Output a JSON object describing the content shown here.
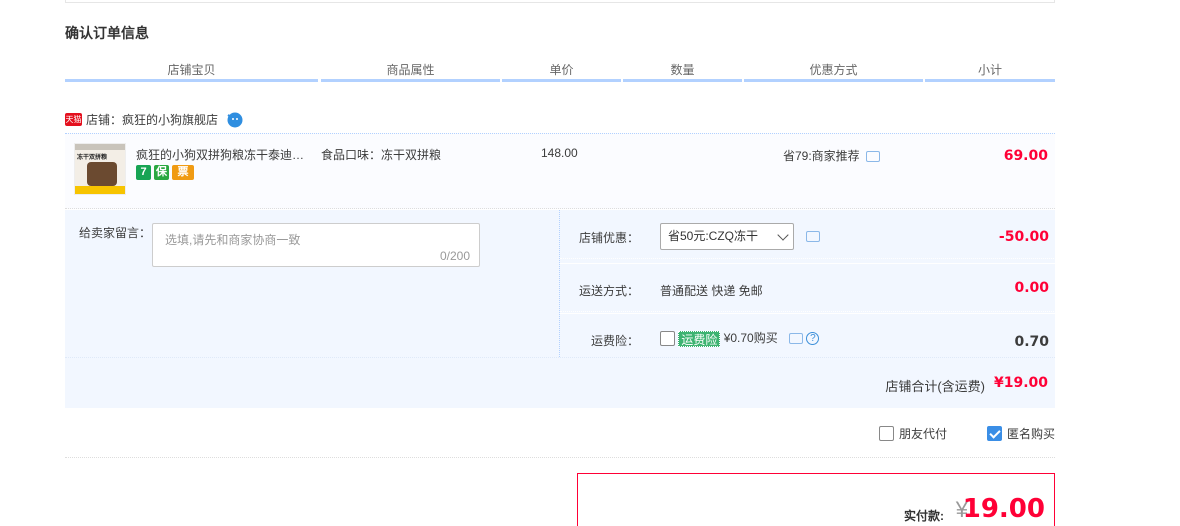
{
  "section_title": "确认订单信息",
  "table_headers": [
    "店铺宝贝",
    "商品属性",
    "单价",
    "数量",
    "优惠方式",
    "小计"
  ],
  "shop": {
    "tmall_badge": "天猫",
    "name": "店铺：疯狂的小狗旗舰店",
    "chat_icon": "wangwang-icon"
  },
  "item": {
    "thumb_text": "冻干双拼粮",
    "title": "疯狂的小狗双拼狗粮冻干泰迪比熊小型犬幼犬成犬通用",
    "badges": [
      "7",
      "保",
      "票"
    ],
    "attr": "食品口味：冻干双拼粮",
    "price": "148.00",
    "promo": "省79:商家推荐",
    "subtotal": "69.00"
  },
  "memo": {
    "label": "给卖家留言：",
    "placeholder": "选填,请先和商家协商一致",
    "count": "0/200"
  },
  "options": {
    "shop_discount": {
      "label": "店铺优惠：",
      "value": "省50元:CZQ冻干",
      "amount": "-50.00"
    },
    "shipping": {
      "label": "运送方式：",
      "value": "普通配送 快递 免邮",
      "amount": "0.00"
    },
    "insurance": {
      "label": "运费险：",
      "tag": "运费险",
      "value": "¥0.70购买",
      "amount": "0.70"
    }
  },
  "shop_total": {
    "label": "店铺合计(含运费)",
    "amount": "¥19.00"
  },
  "pay_options": {
    "friend_pay": "朋友代付",
    "anonymous": "匿名购买",
    "anonymous_checked": true
  },
  "payment": {
    "label": "实付款:",
    "currency": "¥",
    "amount": "19.00"
  },
  "colors": {
    "accent_red": "#ff0036",
    "header_line": "#b2d1ff",
    "panel_bg": "#f2f7ff"
  }
}
